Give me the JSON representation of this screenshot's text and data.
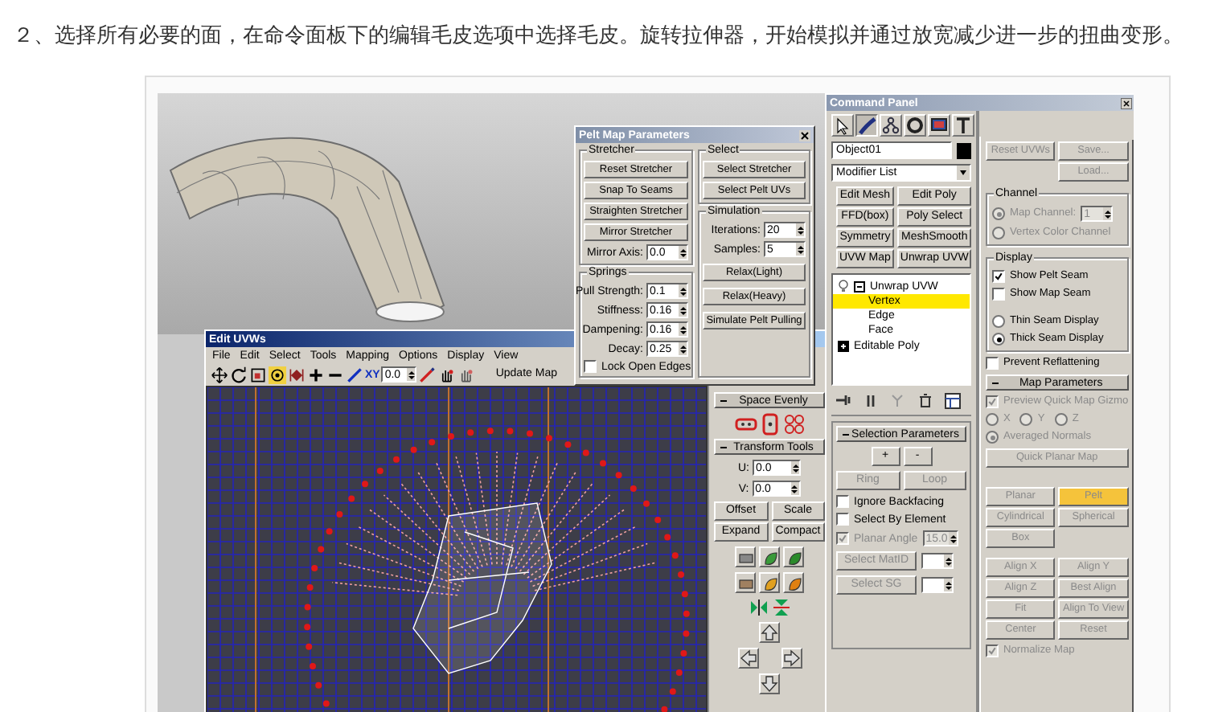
{
  "heading": "２、选择所有必要的面，在命令面板下的编辑毛皮选项中选择毛皮。旋转拉伸器，开始模拟并通过放宽减少进一步的扭曲变形。",
  "pelt_dialog": {
    "title": "Pelt Map Parameters",
    "stretcher": {
      "title": "Stretcher",
      "buttons": [
        "Reset Stretcher",
        "Snap To Seams",
        "Straighten Stretcher",
        "Mirror Stretcher"
      ],
      "mirror_axis": {
        "label": "Mirror Axis:",
        "value": "0.0"
      }
    },
    "springs": {
      "title": "Springs",
      "fields": [
        {
          "label": "Pull Strength:",
          "value": "0.1"
        },
        {
          "label": "Stiffness:",
          "value": "0.16"
        },
        {
          "label": "Dampening:",
          "value": "0.16"
        },
        {
          "label": "Decay:",
          "value": "0.25"
        }
      ],
      "lock_open_edges": {
        "label": "Lock Open Edges",
        "checked": false
      }
    },
    "select": {
      "title": "Select",
      "buttons": [
        "Select Stretcher",
        "Select Pelt UVs"
      ]
    },
    "simulation": {
      "title": "Simulation",
      "fields": [
        {
          "label": "Iterations:",
          "value": "20"
        },
        {
          "label": "Samples:",
          "value": "5"
        }
      ],
      "buttons": [
        "Relax(Light)",
        "Relax(Heavy)",
        "Simulate Pelt Pulling"
      ]
    }
  },
  "edit_uvw": {
    "title": "Edit UVWs",
    "menu": [
      "File",
      "Edit",
      "Select",
      "Tools",
      "Mapping",
      "Options",
      "Display",
      "View"
    ],
    "axis": "XY",
    "value": "0.0",
    "update_button": "Update Map",
    "space_evenly": "Space Evenly",
    "transform_tools": {
      "title": "Transform Tools",
      "fields": [
        {
          "label": "U:",
          "value": "0.0"
        },
        {
          "label": "V:",
          "value": "0.0"
        }
      ],
      "buttons": [
        "Offset",
        "Scale",
        "Expand",
        "Compact"
      ]
    }
  },
  "command_panel": {
    "title": "Command Panel",
    "object_name": "Object01",
    "modifier_list": "Modifier List",
    "modifier_buttons": [
      "Edit Mesh",
      "Edit Poly",
      "FFD(box)",
      "Poly Select",
      "Symmetry",
      "MeshSmooth",
      "UVW Map",
      "Unwrap UVW"
    ],
    "stack": [
      {
        "label": "Unwrap UVW",
        "expanded": true,
        "children": [
          {
            "label": "Vertex",
            "selected": true
          },
          {
            "label": "Edge",
            "selected": false
          },
          {
            "label": "Face",
            "selected": false
          }
        ]
      },
      {
        "label": "Editable Poly",
        "expanded": false
      }
    ],
    "selection_parameters": {
      "title": "Selection Parameters",
      "grow_shrink": [
        "+",
        "-"
      ],
      "ring_loop": [
        {
          "label": "Ring",
          "disabled": true
        },
        {
          "label": "Loop",
          "disabled": true
        }
      ],
      "checks": [
        {
          "label": "Ignore Backfacing",
          "checked": false,
          "disabled": false
        },
        {
          "label": "Select By Element",
          "checked": false,
          "disabled": false
        },
        {
          "label": "Planar Angle",
          "checked": true,
          "disabled": true,
          "value": "15.0"
        }
      ],
      "id_buttons": [
        {
          "label": "Select MatID",
          "disabled": true
        },
        {
          "label": "Select SG",
          "disabled": true
        }
      ]
    },
    "file_buttons": [
      {
        "label": "Reset UVWs",
        "disabled": true
      },
      {
        "label": "Save...",
        "disabled": true
      },
      {
        "label": "Load...",
        "disabled": true
      }
    ],
    "channel": {
      "title": "Channel",
      "options": [
        {
          "label": "Map Channel:",
          "selected": true,
          "disabled": true,
          "value": "1"
        },
        {
          "label": "Vertex Color Channel",
          "selected": false,
          "disabled": true
        }
      ]
    },
    "display": {
      "title": "Display",
      "checks": [
        {
          "label": "Show Pelt Seam",
          "checked": true,
          "disabled": false
        },
        {
          "label": "Show Map Seam",
          "checked": false,
          "disabled": false
        }
      ],
      "radios": [
        {
          "label": "Thin Seam Display",
          "selected": false,
          "disabled": false
        },
        {
          "label": "Thick Seam Display",
          "selected": true,
          "disabled": false
        }
      ]
    },
    "prevent_reflattening": {
      "label": "Prevent Reflattening",
      "checked": false,
      "disabled": false
    },
    "map_parameters": {
      "title": "Map Parameters",
      "preview": {
        "label": "Preview Quick Map Gizmo",
        "checked": true,
        "disabled": true
      },
      "axes": [
        {
          "label": "X",
          "selected": false,
          "disabled": true
        },
        {
          "label": "Y",
          "selected": false,
          "disabled": true
        },
        {
          "label": "Z",
          "selected": false,
          "disabled": true
        }
      ],
      "averaged": {
        "label": "Averaged Normals",
        "selected": true,
        "disabled": true
      },
      "quick_planar": {
        "label": "Quick Planar Map",
        "disabled": true
      },
      "map_buttons": [
        {
          "label": "Planar",
          "selected": false,
          "disabled": true
        },
        {
          "label": "Pelt",
          "selected": true,
          "disabled": true
        },
        {
          "label": "Cylindrical",
          "selected": false,
          "disabled": true
        },
        {
          "label": "Spherical",
          "selected": false,
          "disabled": true
        },
        {
          "label": "Box",
          "selected": false,
          "disabled": true
        }
      ],
      "align_buttons": [
        {
          "label": "Align X",
          "disabled": true
        },
        {
          "label": "Align Y",
          "disabled": true
        },
        {
          "label": "Align Z",
          "disabled": true
        },
        {
          "label": "Best Align",
          "disabled": true
        },
        {
          "label": "Fit",
          "disabled": true
        },
        {
          "label": "Align To View",
          "disabled": true
        },
        {
          "label": "Center",
          "disabled": true
        },
        {
          "label": "Reset",
          "disabled": true
        }
      ],
      "normalize": {
        "label": "Normalize Map",
        "checked": true,
        "disabled": true
      }
    }
  }
}
